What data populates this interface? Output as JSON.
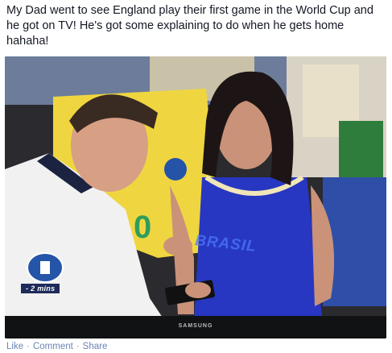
{
  "post": {
    "text": "My Dad went to see England play their first game in the World Cup and he got on TV! He's got some explaining to do when he gets home hahaha!"
  },
  "photo": {
    "overlay_time": "- 2 mins",
    "tv_brand": "SAMSUNG",
    "shirt_text": "BRASIL"
  },
  "actions": {
    "like": "Like",
    "comment": "Comment",
    "share": "Share",
    "separator": "·"
  }
}
